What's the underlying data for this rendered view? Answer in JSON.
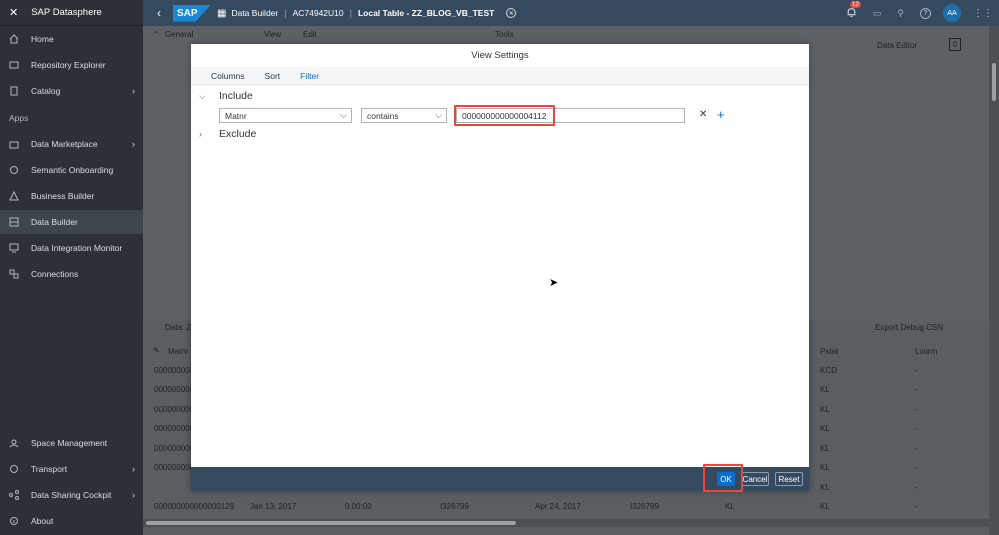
{
  "app": {
    "title": "SAP Datasphere",
    "logo": "SAP"
  },
  "sidenav": {
    "items": [
      {
        "label": "Home",
        "icon": "home-icon"
      },
      {
        "label": "Repository Explorer",
        "icon": "folder-icon"
      },
      {
        "label": "Catalog",
        "icon": "catalog-icon",
        "chevron": true
      }
    ],
    "section_apps": "Apps",
    "apps": [
      {
        "label": "Data Marketplace",
        "icon": "marketplace-icon",
        "chevron": true
      },
      {
        "label": "Semantic Onboarding",
        "icon": "onboarding-icon"
      },
      {
        "label": "Business Builder",
        "icon": "business-builder-icon"
      },
      {
        "label": "Data Builder",
        "icon": "data-builder-icon",
        "active": true
      },
      {
        "label": "Data Integration Monitor",
        "icon": "monitor-icon"
      },
      {
        "label": "Connections",
        "icon": "connections-icon"
      }
    ],
    "bottom": [
      {
        "label": "Space Management",
        "icon": "space-icon"
      },
      {
        "label": "Transport",
        "icon": "transport-icon",
        "chevron": true
      },
      {
        "label": "Data Sharing Cockpit",
        "icon": "share-icon",
        "chevron": true
      },
      {
        "label": "About",
        "icon": "info-icon"
      }
    ]
  },
  "shellbar": {
    "breadcrumb_builder": "Data Builder",
    "breadcrumb_space": "AC74942U10",
    "breadcrumb_object": "Local Table - ZZ_BLOG_VB_TEST",
    "notification_count": "12",
    "avatar": "AA"
  },
  "background": {
    "tab_general": "General",
    "tab_view": "View",
    "tab_edit": "Edit",
    "tab_tools": "Tools",
    "data_editor": "Data Editor",
    "counter": "0",
    "data_label": "Data: Z",
    "export_debug": "Export Debug CSN",
    "col_matnr": "Matnr",
    "col_pstat": "Pstat",
    "col_lvorm": "Lvorm",
    "rows": [
      {
        "matnr": "000000000",
        "pstat": "KCD",
        "lvorm": "-"
      },
      {
        "matnr": "000000000",
        "pstat": "KL",
        "lvorm": "-"
      },
      {
        "matnr": "000000000",
        "pstat": "KL",
        "lvorm": "-"
      },
      {
        "matnr": "000000000",
        "pstat": "KL",
        "lvorm": "-"
      },
      {
        "matnr": "000000000",
        "pstat": "KL",
        "lvorm": "-"
      },
      {
        "matnr": "000000000",
        "pstat": "KL",
        "lvorm": "-"
      },
      {
        "matnr": "000000000",
        "pstat": "KL",
        "lvorm": "-"
      }
    ],
    "last_row": {
      "matnr": "000000000000000129",
      "date1": "Jan 13, 2017",
      "time": "0:00:00",
      "user1": "I326799",
      "date2": "Apr 24, 2017",
      "user2": "I326799",
      "kl1": "KL",
      "pstat": "KL",
      "lvorm": "-"
    }
  },
  "dialog": {
    "title": "View Settings",
    "tabs": [
      "Columns",
      "Sort",
      "Filter"
    ],
    "selected_tab": "Filter",
    "include_label": "Include",
    "exclude_label": "Exclude",
    "filter": {
      "column": "Matnr",
      "operator": "contains",
      "value": "000000000000004112"
    },
    "buttons": {
      "ok": "OK",
      "cancel": "Cancel",
      "reset": "Reset"
    }
  },
  "colors": {
    "shell": "#354a5f",
    "sidenav": "#2b3136",
    "accent": "#0a6ed1",
    "highlight": "#e9473b"
  }
}
